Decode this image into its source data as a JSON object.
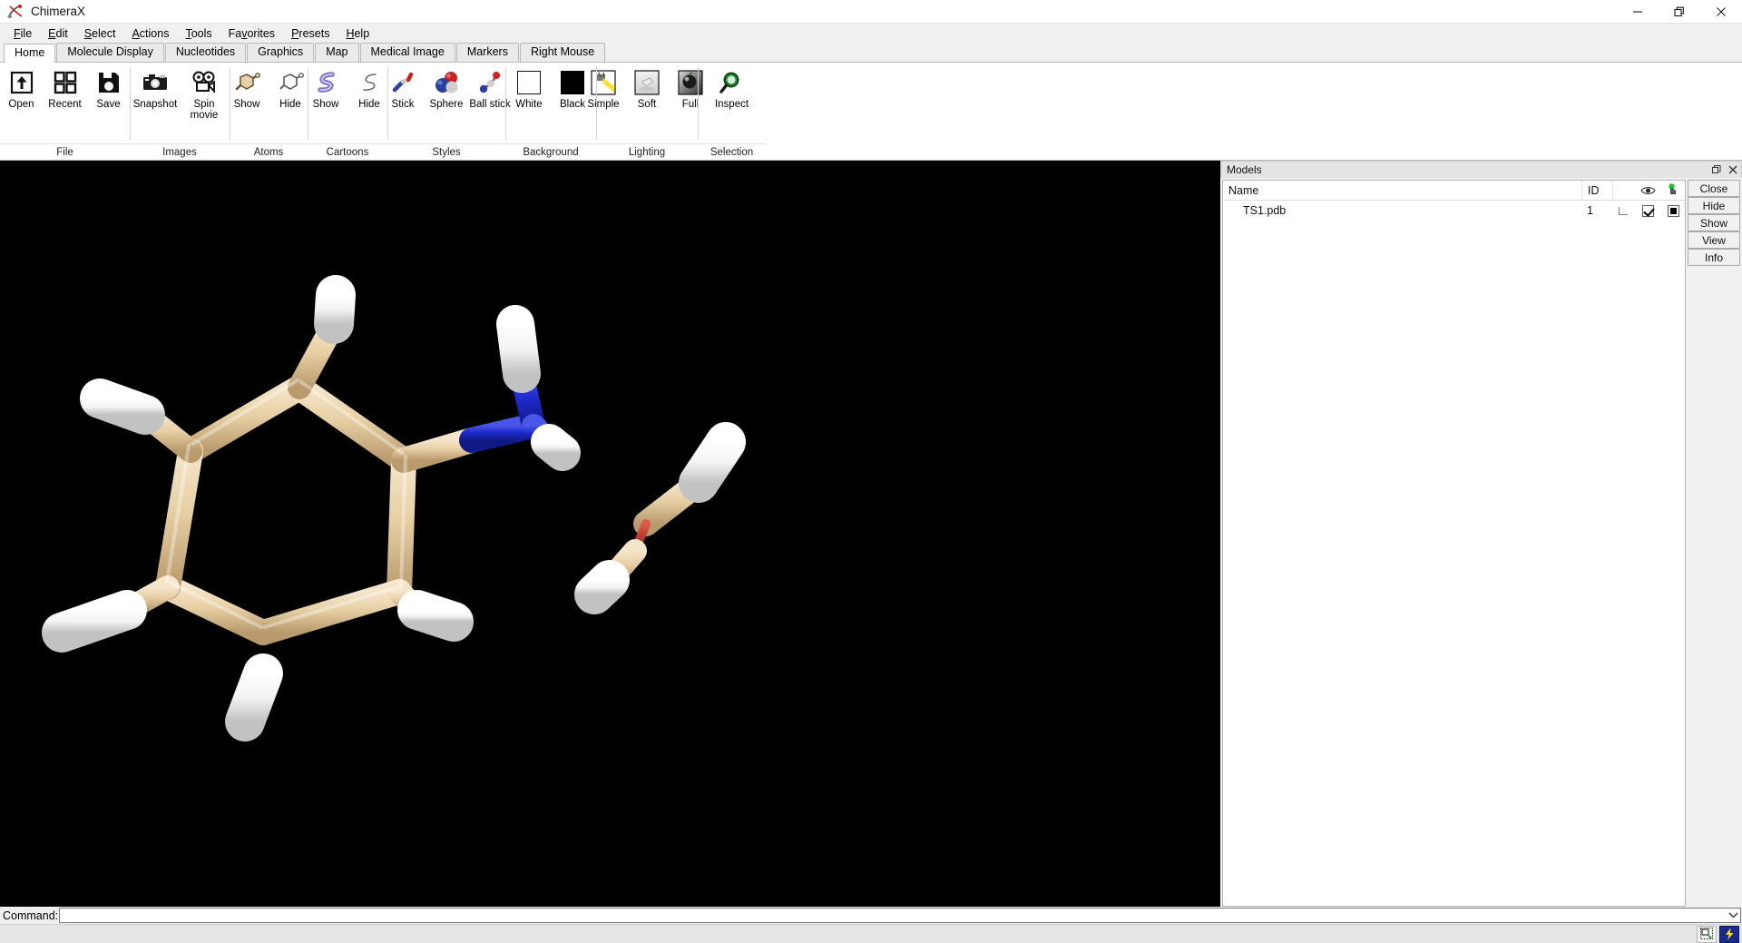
{
  "window": {
    "title": "ChimeraX",
    "app_icon": "chimerax-logo-icon",
    "controls": {
      "minimize": "—",
      "restore": "❐",
      "close": "✕"
    }
  },
  "menubar": {
    "items": [
      {
        "label": "File",
        "accel": "F"
      },
      {
        "label": "Edit",
        "accel": "E"
      },
      {
        "label": "Select",
        "accel": "S"
      },
      {
        "label": "Actions",
        "accel": "A"
      },
      {
        "label": "Tools",
        "accel": "T"
      },
      {
        "label": "Favorites",
        "accel": "v"
      },
      {
        "label": "Presets",
        "accel": "P"
      },
      {
        "label": "Help",
        "accel": "H"
      }
    ]
  },
  "ribbon": {
    "tabs": [
      {
        "label": "Home",
        "active": true
      },
      {
        "label": "Molecule Display",
        "active": false
      },
      {
        "label": "Nucleotides",
        "active": false
      },
      {
        "label": "Graphics",
        "active": false
      },
      {
        "label": "Map",
        "active": false
      },
      {
        "label": "Medical Image",
        "active": false
      },
      {
        "label": "Markers",
        "active": false
      },
      {
        "label": "Right Mouse",
        "active": false
      }
    ],
    "groups": [
      {
        "label": "File",
        "items": [
          {
            "label": "Open",
            "icon": "open-folder-arrow-icon"
          },
          {
            "label": "Recent",
            "icon": "recent-grid-icon"
          },
          {
            "label": "Save",
            "icon": "save-floppy-icon"
          }
        ]
      },
      {
        "label": "Images",
        "items": [
          {
            "label": "Snapshot",
            "icon": "camera-icon"
          },
          {
            "label": "Spin movie",
            "icon": "movie-camera-icon"
          }
        ]
      },
      {
        "label": "Atoms",
        "items": [
          {
            "label": "Show",
            "icon": "atoms-show-icon"
          },
          {
            "label": "Hide",
            "icon": "atoms-hide-icon"
          }
        ]
      },
      {
        "label": "Cartoons",
        "items": [
          {
            "label": "Show",
            "icon": "cartoon-show-icon"
          },
          {
            "label": "Hide",
            "icon": "cartoon-hide-icon"
          }
        ]
      },
      {
        "label": "Styles",
        "items": [
          {
            "label": "Stick",
            "icon": "stick-style-icon"
          },
          {
            "label": "Sphere",
            "icon": "sphere-style-icon"
          },
          {
            "label": "Ball stick",
            "icon": "ball-stick-style-icon"
          }
        ]
      },
      {
        "label": "Background",
        "items": [
          {
            "label": "White",
            "icon": "white-background-icon"
          },
          {
            "label": "Black",
            "icon": "black-background-icon"
          }
        ]
      },
      {
        "label": "Lighting",
        "items": [
          {
            "label": "Simple",
            "icon": "lighting-simple-icon"
          },
          {
            "label": "Soft",
            "icon": "lighting-soft-icon"
          },
          {
            "label": "Full",
            "icon": "lighting-full-icon"
          }
        ]
      },
      {
        "label": "Selection",
        "items": [
          {
            "label": "Inspect",
            "icon": "inspect-magnifier-icon"
          }
        ]
      }
    ]
  },
  "viewport": {
    "background_color": "#000000",
    "molecule": {
      "description": "aniline and methanol ball-and-stick transition state structure",
      "colors": {
        "carbon": "#e8d1a8",
        "hydrogen": "#ffffff",
        "nitrogen": "#1a23cf",
        "oxygen": "#c0392b"
      }
    }
  },
  "models_panel": {
    "title": "Models",
    "header_buttons": {
      "float": "❐",
      "close": "✕"
    },
    "columns": [
      {
        "key": "name",
        "label": "Name"
      },
      {
        "key": "id",
        "label": "ID"
      },
      {
        "key": "sel",
        "label": ""
      },
      {
        "key": "shown",
        "label": "eye-icon"
      },
      {
        "key": "color",
        "label": "green-hand-pointer-icon"
      }
    ],
    "rows": [
      {
        "name": "TS1.pdb",
        "id": "1",
        "sel": "selection-corner",
        "shown": true,
        "color": "#000000"
      }
    ],
    "buttons": [
      {
        "label": "Close"
      },
      {
        "label": "Hide"
      },
      {
        "label": "Show"
      },
      {
        "label": "View"
      },
      {
        "label": "Info"
      }
    ]
  },
  "command_line": {
    "label": "Command:",
    "value": "",
    "placeholder": "",
    "dropdown_icon": "chevron-down-icon"
  },
  "status_bar": {
    "text": "",
    "icons": [
      {
        "name": "resize-region-icon"
      },
      {
        "name": "lightning-bolt-icon",
        "color": "#ffe000",
        "background": "#1a2a8a"
      }
    ]
  }
}
